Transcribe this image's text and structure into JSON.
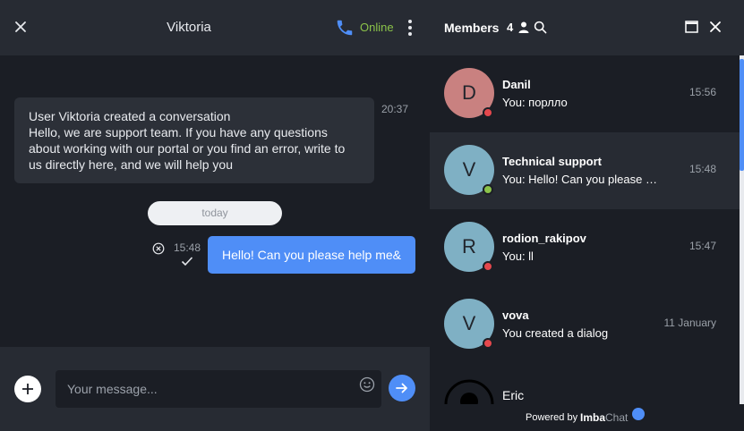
{
  "chat": {
    "title": "Viktoria",
    "status": "Online",
    "system_message": {
      "lines": [
        "User Viktoria created a conversation",
        "Hello, we are support team. If you have any questions about working with our portal or you find an error, write to us directly here, and we will help you"
      ],
      "time": "20:37"
    },
    "day_divider": "today",
    "outgoing": {
      "text": "Hello! Can you please help me&",
      "time": "15:48"
    },
    "input": {
      "placeholder": "Your message...",
      "value": ""
    }
  },
  "members": {
    "title": "Members",
    "count": "4",
    "items": [
      {
        "initial": "D",
        "name": "Danil",
        "preview": "You: порлло",
        "time": "15:56",
        "avatar_color": "#c98180",
        "status": "offline",
        "status_color": "#e5484d"
      },
      {
        "initial": "V",
        "name": "Technical support",
        "preview": "You: Hello! Can you please help me&",
        "time": "15:48",
        "avatar_color": "#7fb0c4",
        "status": "online",
        "status_color": "#8bc34a"
      },
      {
        "initial": "R",
        "name": "rodion_rakipov",
        "preview": "You: ll",
        "time": "15:47",
        "avatar_color": "#7fb0c4",
        "status": "offline",
        "status_color": "#e5484d"
      },
      {
        "initial": "V",
        "name": "vova",
        "preview": "You created a dialog",
        "time": "11 January",
        "avatar_color": "#7fb0c4",
        "status": "offline",
        "status_color": "#e5484d"
      },
      {
        "initial": "",
        "name": "Eric",
        "preview": "",
        "time": "",
        "avatar_color": "#1b1e25",
        "status": "",
        "status_color": ""
      }
    ]
  },
  "footer": {
    "powered_by": "Powered by",
    "brand_main": "Imba",
    "brand_soft": "Chat"
  },
  "icons": [
    "close-icon",
    "phone-icon",
    "more-vertical-icon",
    "cancel-circle-icon",
    "checkmark-icon",
    "plus-icon",
    "emoji-icon",
    "send-arrow-icon",
    "user-icon",
    "search-icon",
    "maximize-icon",
    "brand-bubble-icon"
  ],
  "colors": {
    "accent": "#4f8ef7",
    "online": "#8bc34a",
    "offline": "#e5484d",
    "panel": "#272b33",
    "background": "#1b1e25"
  }
}
